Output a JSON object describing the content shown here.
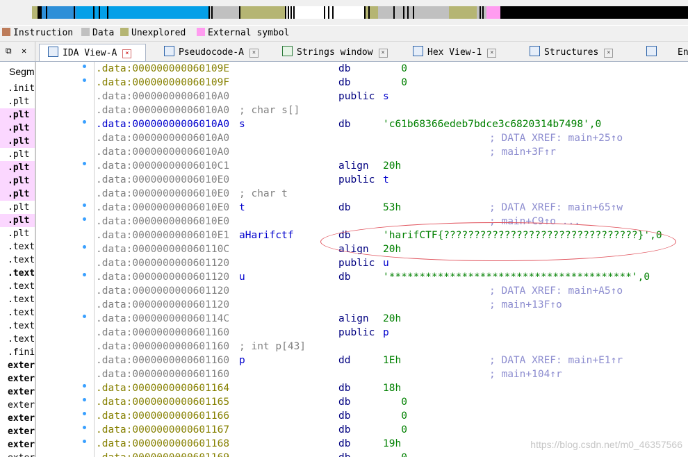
{
  "legend": [
    {
      "label": "Instruction",
      "color": "#bd7c5a"
    },
    {
      "label": "Data",
      "color": "#c0c0c0"
    },
    {
      "label": "Unexplored",
      "color": "#b5b573"
    },
    {
      "label": "External symbol",
      "color": "#ff9cf0"
    }
  ],
  "left_controls": {
    "float": "⧉",
    "close": "✕"
  },
  "tabs": [
    {
      "label": "IDA View-A",
      "close": "×"
    },
    {
      "label": "Pseudocode-A",
      "close": "×"
    },
    {
      "label": "Strings window",
      "close": "×"
    },
    {
      "label": "Hex View-1",
      "close": "×"
    },
    {
      "label": "Structures",
      "close": "×"
    },
    {
      "label": "En",
      "close": ""
    }
  ],
  "segments": {
    "title": "Segm",
    "rows": [
      ".init",
      ".plt",
      ".plt",
      ".plt",
      ".plt",
      ".plt",
      ".plt",
      ".plt",
      ".plt",
      ".plt",
      ".plt",
      ".plt",
      ".text",
      ".text",
      ".text",
      ".text",
      ".text",
      ".text",
      ".text",
      ".text",
      ".fini",
      "exter",
      "exter",
      "exter",
      "exter",
      "exter",
      "exter",
      "exter",
      "exter"
    ]
  },
  "lines": [
    {
      "addr": ".data:000000000060109E",
      "label": "",
      "mnem": "db",
      "opnd": "   0",
      "xref": "",
      "style": "olive"
    },
    {
      "addr": ".data:000000000060109F",
      "label": "",
      "mnem": "db",
      "opnd": "   0",
      "xref": "",
      "style": "olive"
    },
    {
      "addr": ".data:00000000006010A0",
      "label": "",
      "mnem": "public",
      "opnd": "s",
      "xref": "",
      "style": "grey"
    },
    {
      "addr": ".data:00000000006010A0",
      "label": "; char s[]",
      "mnem": "",
      "opnd": "",
      "xref": "",
      "style": "grey"
    },
    {
      "addr": ".data:00000000006010A0",
      "label": "s",
      "mnem": "db",
      "opnd": "'c61b68366edeb7bdce3c6820314b7498',0",
      "xref": "",
      "style": "blue"
    },
    {
      "addr": ".data:00000000006010A0",
      "label": "",
      "mnem": "",
      "opnd": "",
      "xref": "; DATA XREF: main+25↑o",
      "style": "grey"
    },
    {
      "addr": ".data:00000000006010A0",
      "label": "",
      "mnem": "",
      "opnd": "",
      "xref": "; main+3F↑r",
      "style": "grey"
    },
    {
      "addr": ".data:00000000006010C1",
      "label": "",
      "mnem": "align",
      "opnd": "20h",
      "xref": "",
      "style": "grey"
    },
    {
      "addr": ".data:00000000006010E0",
      "label": "",
      "mnem": "public",
      "opnd": "t",
      "xref": "",
      "style": "grey"
    },
    {
      "addr": ".data:00000000006010E0",
      "label": "; char t",
      "mnem": "",
      "opnd": "",
      "xref": "",
      "style": "grey"
    },
    {
      "addr": ".data:00000000006010E0",
      "label": "t",
      "mnem": "db",
      "opnd": "53h",
      "xref": "; DATA XREF: main+65↑w",
      "style": "grey"
    },
    {
      "addr": ".data:00000000006010E0",
      "label": "",
      "mnem": "",
      "opnd": "",
      "xref": "; main+C9↑o ...",
      "style": "grey"
    },
    {
      "addr": ".data:00000000006010E1",
      "label": "aHarifctf",
      "mnem": "db",
      "opnd": "'harifCTF{????????????????????????????????}',0",
      "xref": "",
      "style": "grey"
    },
    {
      "addr": ".data:000000000060110C",
      "label": "",
      "mnem": "align",
      "opnd": "20h",
      "xref": "",
      "style": "grey"
    },
    {
      "addr": ".data:0000000000601120",
      "label": "",
      "mnem": "public",
      "opnd": "u",
      "xref": "",
      "style": "grey"
    },
    {
      "addr": ".data:0000000000601120",
      "label": "u",
      "mnem": "db",
      "opnd": "'****************************************',0",
      "xref": "",
      "style": "grey"
    },
    {
      "addr": ".data:0000000000601120",
      "label": "",
      "mnem": "",
      "opnd": "",
      "xref": "; DATA XREF: main+A5↑o",
      "style": "grey"
    },
    {
      "addr": ".data:0000000000601120",
      "label": "",
      "mnem": "",
      "opnd": "",
      "xref": "; main+13F↑o",
      "style": "grey"
    },
    {
      "addr": ".data:000000000060114C",
      "label": "",
      "mnem": "align",
      "opnd": "20h",
      "xref": "",
      "style": "grey"
    },
    {
      "addr": ".data:0000000000601160",
      "label": "",
      "mnem": "public",
      "opnd": "p",
      "xref": "",
      "style": "grey"
    },
    {
      "addr": ".data:0000000000601160",
      "label": "; int p[43]",
      "mnem": "",
      "opnd": "",
      "xref": "",
      "style": "grey"
    },
    {
      "addr": ".data:0000000000601160",
      "label": "p",
      "mnem": "dd",
      "opnd": "1Eh",
      "xref": "; DATA XREF: main+E1↑r",
      "style": "grey"
    },
    {
      "addr": ".data:0000000000601160",
      "label": "",
      "mnem": "",
      "opnd": "",
      "xref": "; main+104↑r",
      "style": "grey"
    },
    {
      "addr": ".data:0000000000601164",
      "label": "",
      "mnem": "db",
      "opnd": "18h",
      "xref": "",
      "style": "olive"
    },
    {
      "addr": ".data:0000000000601165",
      "label": "",
      "mnem": "db",
      "opnd": "   0",
      "xref": "",
      "style": "olive"
    },
    {
      "addr": ".data:0000000000601166",
      "label": "",
      "mnem": "db",
      "opnd": "   0",
      "xref": "",
      "style": "olive"
    },
    {
      "addr": ".data:0000000000601167",
      "label": "",
      "mnem": "db",
      "opnd": "   0",
      "xref": "",
      "style": "olive"
    },
    {
      "addr": ".data:0000000000601168",
      "label": "",
      "mnem": "db",
      "opnd": "19h",
      "xref": "",
      "style": "olive"
    },
    {
      "addr": ".data:0000000000601169",
      "label": "",
      "mnem": "db",
      "opnd": "   0",
      "xref": "",
      "style": "olive"
    }
  ],
  "watermark": "https://blog.csdn.net/m0_46357566"
}
